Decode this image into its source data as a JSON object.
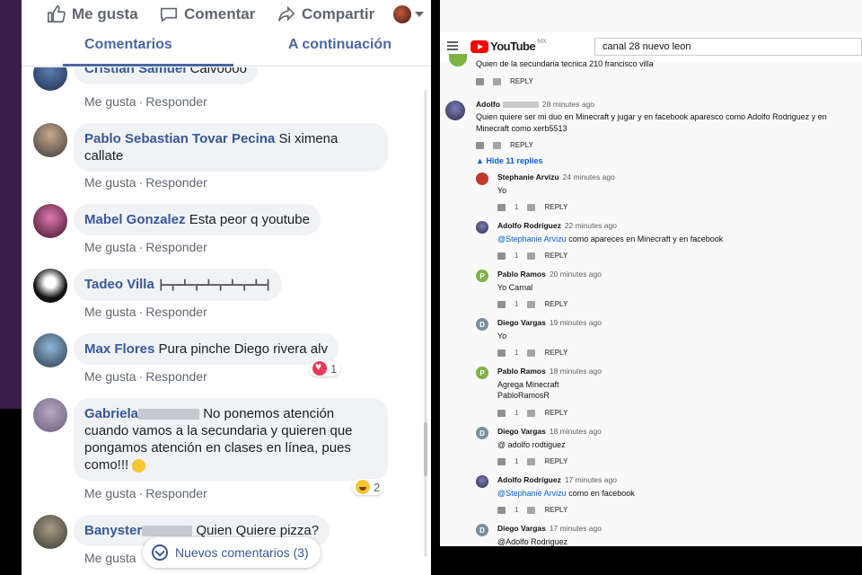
{
  "facebook": {
    "actions": {
      "like": "Me gusta",
      "comment": "Comentar",
      "share": "Compartir"
    },
    "tabs": {
      "comments": "Comentarios",
      "next": "A continuación"
    },
    "meta": {
      "like": "Me gusta",
      "reply": "Responder",
      "dot": "·"
    },
    "comments": [
      {
        "author": "Cristian Samuel",
        "text": "Calvoooo"
      },
      {
        "author": "Pablo Sebastian Tovar Pecina",
        "text": "Si ximena callate"
      },
      {
        "author": "Mabel Gonzalez",
        "text": "Esta peor q youtube"
      },
      {
        "author": "Tadeo Villa",
        "text": "┣━┳━┻━┳━┻━┳━┻━┳━┻━┫"
      },
      {
        "author": "Max Flores",
        "text": "Pura pinche Diego rivera alv",
        "reaction_count": "1"
      },
      {
        "author": "Gabriela",
        "text": "No ponemos atención cuando vamos a la secundaria y quieren que pongamos atención en clases en línea, pues como!!!",
        "reaction_count": "2"
      },
      {
        "author": "Banyster",
        "text": "Quien Quiere pizza?"
      }
    ],
    "new_comments": "Nuevos comentarios (3)"
  },
  "youtube": {
    "brand": "YouTube",
    "region": "MX",
    "search_value": "canal 28 nuevo leon",
    "top_comment_text": "Quien de la secundaria tecnica 210 francisco villa",
    "reply_label": "REPLY",
    "main_comment": {
      "author": "Adolfo",
      "ago": "28 minutes ago",
      "text": "Quien quiere ser mi duo en Minecraft y jugar y en facebook aparesco como Adolfo Rodriguez y en Minecraft como xerb5513"
    },
    "hide_replies": "Hide 11 replies",
    "replies": [
      {
        "author": "Stephanie Arvizu",
        "ago": "24 minutes ago",
        "text": "Yo",
        "likes": "1"
      },
      {
        "author": "Adolfo Rodríguez",
        "ago": "22 minutes ago",
        "mention": "@Stephanie Arvizu",
        "text": " como apareces en Minecraft y en facebook",
        "likes": "1"
      },
      {
        "author": "Pablo Ramos",
        "ago": "20 minutes ago",
        "text": "Yo Carnal",
        "likes": "1",
        "initial": "P"
      },
      {
        "author": "Diego Vargas",
        "ago": "19 minutes ago",
        "text": "Yo",
        "likes": "1",
        "initial": "D"
      },
      {
        "author": "Pablo Ramos",
        "ago": "18 minutes ago",
        "text": "Agrega Minecraft",
        "text2": "PabloRamosR",
        "likes": "1",
        "initial": "P"
      },
      {
        "author": "Diego Vargas",
        "ago": "18 minutes ago",
        "text": "@ adolfo rodtiguez",
        "likes": "1",
        "initial": "D"
      },
      {
        "author": "Adolfo Rodríguez",
        "ago": "17 minutes ago",
        "mention": "@Stephanie Arvizu",
        "text": " como en facebook",
        "likes": "1"
      },
      {
        "author": "Diego Vargas",
        "ago": "17 minutes ago",
        "mention": "@Adolfo Rodriguez",
        "text": "",
        "initial": "D"
      }
    ]
  }
}
